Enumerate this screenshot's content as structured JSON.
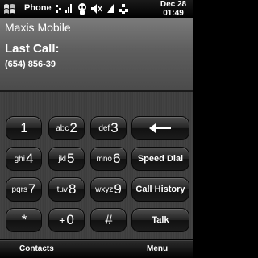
{
  "status_bar": {
    "app_title": "Phone",
    "date": "Dec 28",
    "time": "01:49",
    "icons": [
      "windows-start-icon",
      "connectivity-icon",
      "signal-icon",
      "alien-icon",
      "volume-icon",
      "signal-strength-icon",
      "network-icon"
    ]
  },
  "info": {
    "operator": "Maxis Mobile",
    "last_call_label": "Last Call:",
    "last_call_number": "(654) 856-39"
  },
  "keypad": {
    "keys": [
      {
        "letters": "",
        "digit": "1"
      },
      {
        "letters": "abc",
        "digit": "2"
      },
      {
        "letters": "def",
        "digit": "3"
      },
      {
        "letters": "ghi",
        "digit": "4"
      },
      {
        "letters": "jkl",
        "digit": "5"
      },
      {
        "letters": "mno",
        "digit": "6"
      },
      {
        "letters": "pqrs",
        "digit": "7"
      },
      {
        "letters": "tuv",
        "digit": "8"
      },
      {
        "letters": "wxyz",
        "digit": "9"
      },
      {
        "letters": "",
        "digit": "*"
      },
      {
        "letters": "+",
        "digit": "0"
      },
      {
        "letters": "",
        "digit": "#"
      }
    ],
    "backspace_icon": "backspace-arrow-icon",
    "speed_dial_label": "Speed Dial",
    "call_history_label": "Call History",
    "talk_label": "Talk"
  },
  "softkeys": {
    "left": "Contacts",
    "right": "Menu"
  }
}
